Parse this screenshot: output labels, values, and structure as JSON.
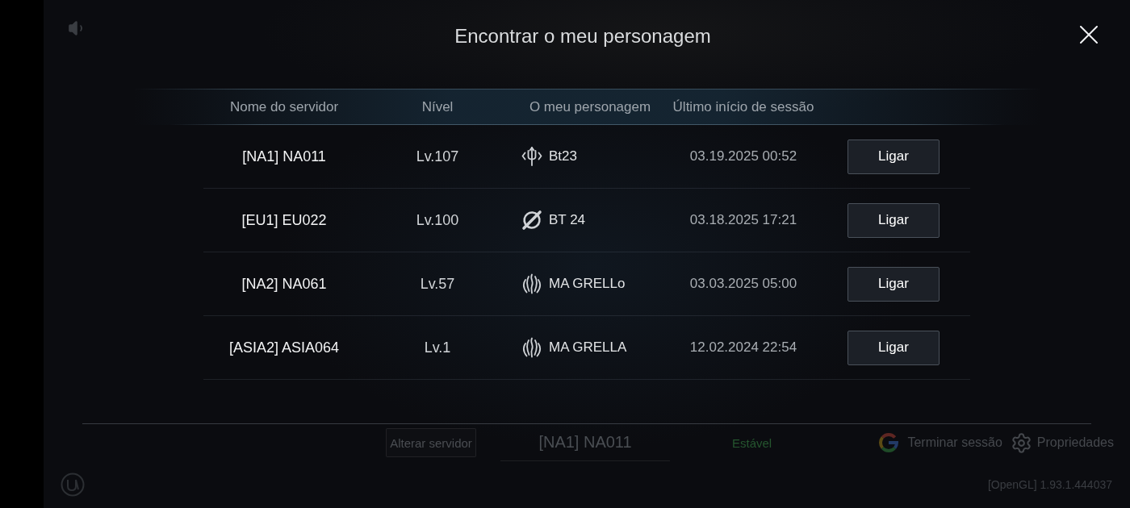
{
  "top_bar": {
    "title": "Encontrar o meu personagem"
  },
  "character_table": {
    "columns": [
      "Nome do servidor",
      "Nível",
      "O meu personagem",
      "Último início de sessão"
    ],
    "rows": [
      {
        "server": "[NA1] NA011",
        "character_level": "Lv.107",
        "kind": "trident",
        "character": "Bt23",
        "last_login": "03.19.2025 00:52",
        "action": "Ligar"
      },
      {
        "server": "[EU1] EU022",
        "character_level": "Lv.100",
        "kind": "blade",
        "character": "BT 24",
        "last_login": "03.18.2025 17:21",
        "action": "Ligar"
      },
      {
        "server": "[NA2] NA061",
        "character_level": "Lv.57",
        "kind": "flame",
        "character": "MA GRELLo",
        "last_login": "03.03.2025 05:00",
        "action": "Ligar"
      },
      {
        "server": "[ASIA2] ASIA064",
        "character_level": "Lv.1",
        "kind": "flame",
        "character": "MA GRELLA",
        "last_login": "12.02.2024 22:54",
        "action": "Ligar"
      }
    ]
  },
  "bottom_bar": {
    "change_server": "Alterar servidor",
    "current_server": "[NA1] NA011",
    "status": "Estável",
    "logout": "Terminar sessão",
    "settings": "Propriedades",
    "version": "[OpenGL] 1.93.1.444037"
  }
}
